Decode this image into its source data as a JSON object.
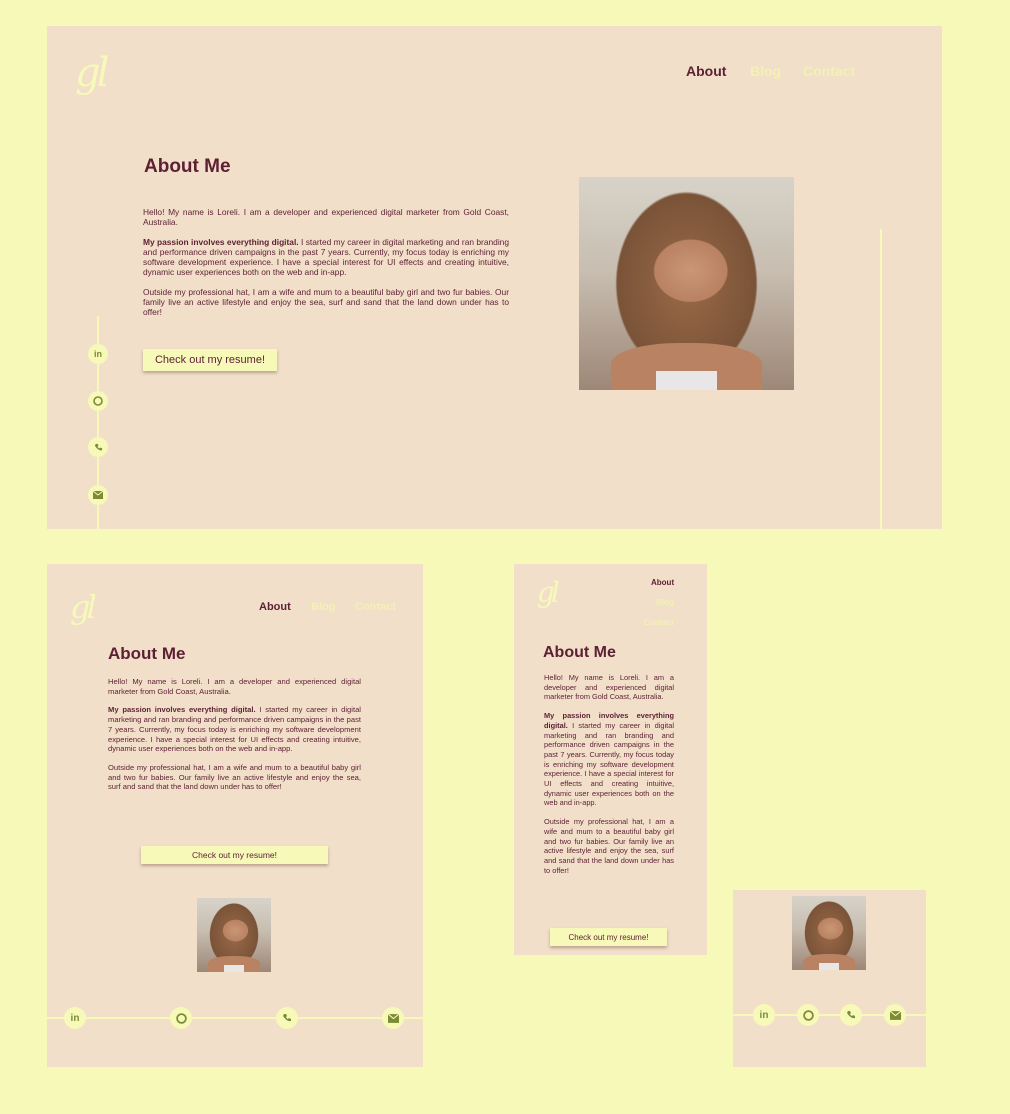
{
  "logo_text": "gl",
  "nav": {
    "about": "About",
    "blog": "Blog",
    "contact": "Contact"
  },
  "heading": "About Me",
  "intro": "Hello! My name is Loreli. I am a developer and experienced digital marketer from Gold Coast, Australia.",
  "passion_bold": "My passion involves everything digital.",
  "passion_rest": " I started my career in digital marketing and ran branding and performance driven campaigns in the past 7 years. Currently, my focus today is enriching my software development experience. I have a special interest for UI effects and creating intuitive, dynamic user experiences both on the web and in-app.",
  "outside": "Outside my professional hat, I am a wife and mum to a beautiful baby girl and two fur babies. Our family live an active lifestyle and enjoy the sea, surf and sand that the land down under has to offer!",
  "resume_button": "Check out my resume!",
  "social_icons": [
    "linkedin-icon",
    "github-icon",
    "phone-icon",
    "email-icon"
  ],
  "colors": {
    "background": "#f6f9b8",
    "panel": "#f1dfc9",
    "text": "#5d1f33",
    "accent": "#f6f9b8"
  }
}
